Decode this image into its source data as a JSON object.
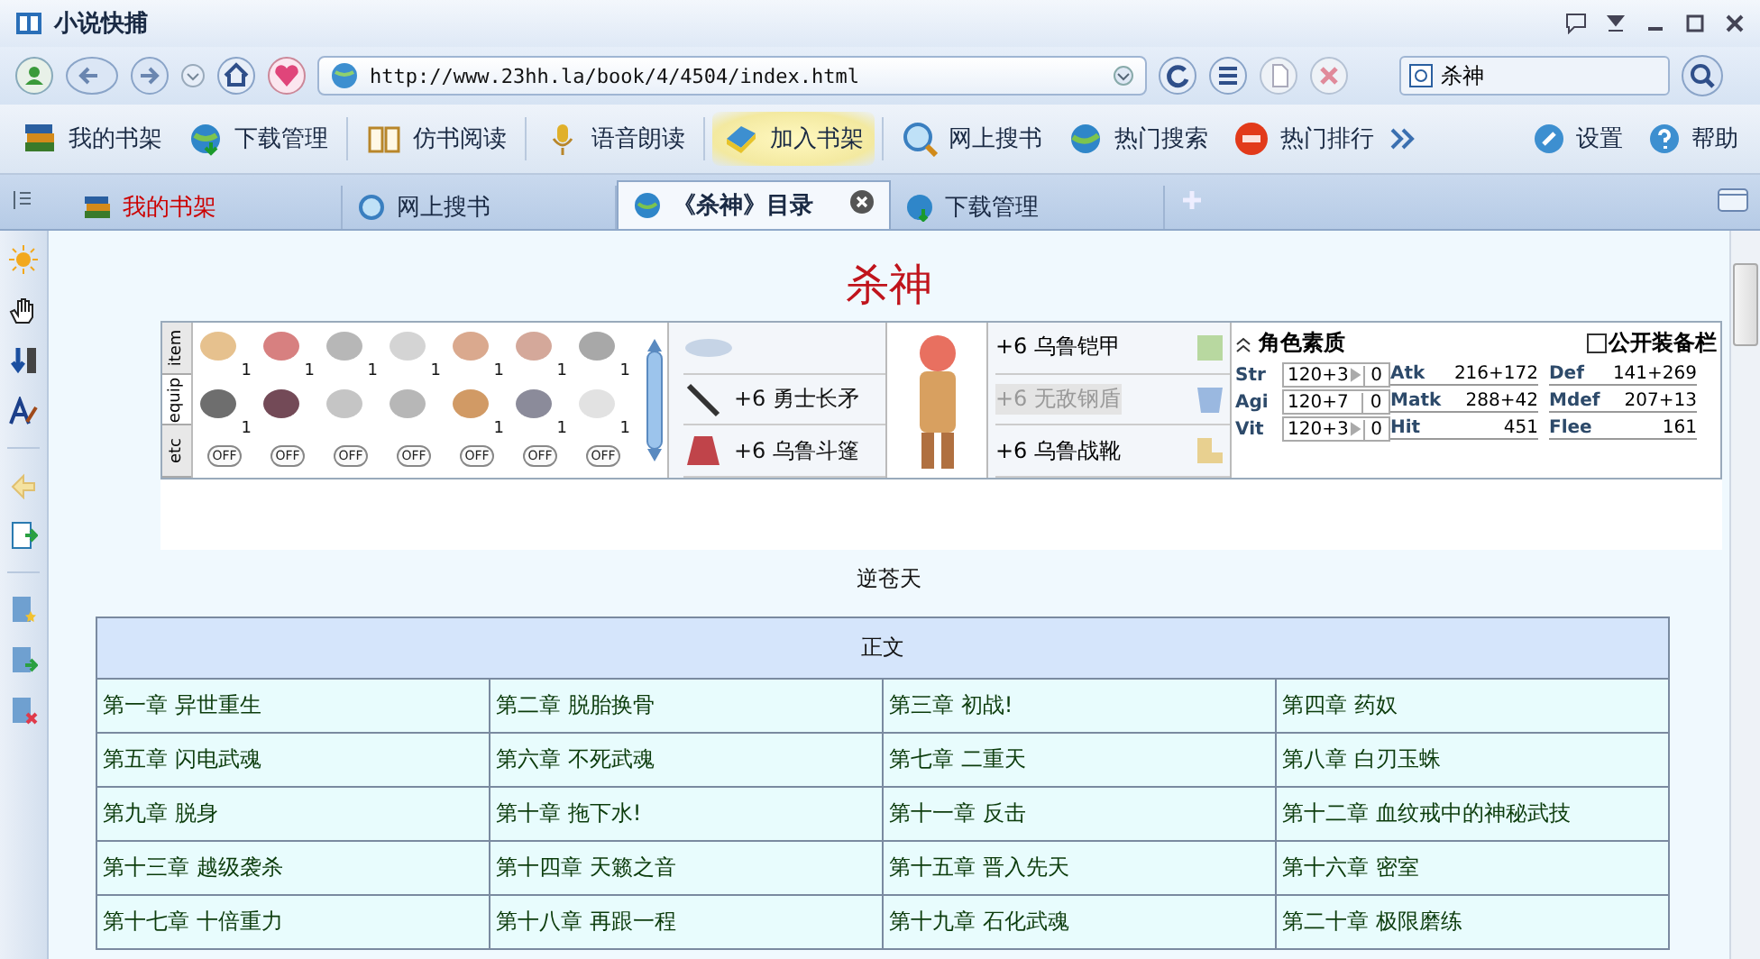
{
  "window": {
    "title": "小说快捕"
  },
  "nav": {
    "url": "http://www.23hh.la/book/4/4504/index.html",
    "search": "杀神"
  },
  "toolbar": [
    {
      "label": "我的书架",
      "highlighted": false
    },
    {
      "label": "下载管理",
      "highlighted": false
    },
    {
      "label": "仿书阅读",
      "highlighted": false
    },
    {
      "label": "语音朗读",
      "highlighted": false
    },
    {
      "label": "加入书架",
      "highlighted": true
    },
    {
      "label": "网上搜书",
      "highlighted": false
    },
    {
      "label": "热门搜索",
      "highlighted": false
    },
    {
      "label": "热门排行",
      "highlighted": false
    }
  ],
  "toolbar_right": [
    {
      "label": "设置"
    },
    {
      "label": "帮助"
    }
  ],
  "tabs": [
    {
      "label": "我的书架",
      "selected": false,
      "color": "#cc0000"
    },
    {
      "label": "网上搜书",
      "selected": false,
      "color": "#1a2a44"
    },
    {
      "label": "《杀神》目录",
      "selected": true,
      "color": "#1a2a44"
    },
    {
      "label": "下载管理",
      "selected": false,
      "color": "#1a2a44"
    }
  ],
  "page": {
    "title": "杀神",
    "banner": {
      "side_tabs": [
        {
          "label": "item",
          "selected": false
        },
        {
          "label": "equip",
          "selected": true
        },
        {
          "label": "etc",
          "selected": false
        }
      ],
      "inventory": [
        {
          "kind": "counted",
          "count": "1"
        },
        {
          "kind": "counted",
          "count": "1"
        },
        {
          "kind": "counted",
          "count": "1"
        },
        {
          "kind": "counted",
          "count": "1"
        },
        {
          "kind": "counted",
          "count": "1"
        },
        {
          "kind": "counted",
          "count": "1"
        },
        {
          "kind": "counted",
          "count": "1"
        },
        {
          "kind": "counted",
          "count": "1"
        },
        {
          "kind": "plain"
        },
        {
          "kind": "plain"
        },
        {
          "kind": "plain"
        },
        {
          "kind": "counted",
          "count": "1"
        },
        {
          "kind": "counted",
          "count": "1"
        },
        {
          "kind": "counted",
          "count": "1"
        }
      ],
      "off_buttons": [
        "OFF",
        "OFF",
        "OFF",
        "OFF",
        "OFF",
        "OFF",
        "OFF"
      ],
      "equip_left": [
        {
          "text": "+6 勇士长矛"
        },
        {
          "text": "+6 乌鲁斗篷"
        }
      ],
      "equip_right": [
        {
          "text": "+6 乌鲁铠甲",
          "disabled": false
        },
        {
          "text": "+6 无敌钢盾",
          "disabled": true
        },
        {
          "text": "+6 乌鲁战靴",
          "disabled": false
        }
      ],
      "stats_title": "角色素质",
      "public_equip": {
        "label": "公开装备栏",
        "checked": false
      },
      "base_stats": [
        {
          "name": "Str",
          "value": "120+3",
          "arrow": true,
          "bonus": "0"
        },
        {
          "name": "Agi",
          "value": "120+7",
          "arrow": false,
          "bonus": "0"
        },
        {
          "name": "Vit",
          "value": "120+3",
          "arrow": true,
          "bonus": "0"
        }
      ],
      "derived_stats": [
        {
          "name": "Atk",
          "value": "216+172"
        },
        {
          "name": "Def",
          "value": "141+269"
        },
        {
          "name": "Matk",
          "value": "288+42"
        },
        {
          "name": "Mdef",
          "value": "207+13"
        },
        {
          "name": "Hit",
          "value": "451"
        },
        {
          "name": "Flee",
          "value": "161"
        }
      ]
    },
    "author": "逆苍天",
    "table": {
      "heading": "正文",
      "rows": [
        [
          "第一章 异世重生",
          "第二章 脱胎换骨",
          "第三章 初战!",
          "第四章 药奴"
        ],
        [
          "第五章 闪电武魂",
          "第六章 不死武魂",
          "第七章 二重天",
          "第八章 白刃玉蛛"
        ],
        [
          "第九章 脱身",
          "第十章 拖下水!",
          "第十一章 反击",
          "第十二章 血纹戒中的神秘武技"
        ],
        [
          "第十三章 越级袭杀",
          "第十四章 天籁之音",
          "第十五章 晋入先天",
          "第十六章 密室"
        ],
        [
          "第十七章 十倍重力",
          "第十八章 再跟一程",
          "第十九章 石化武魂",
          "第二十章 极限磨练"
        ]
      ]
    }
  }
}
